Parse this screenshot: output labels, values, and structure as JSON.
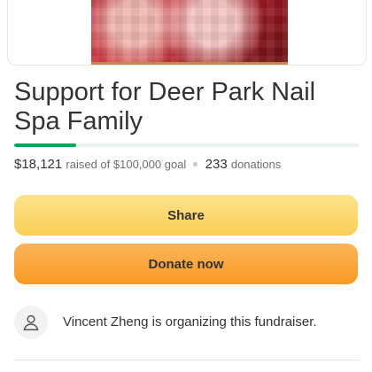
{
  "campaign": {
    "title": "Support for Deer Park Nail Spa Family",
    "progress_fraction": 0.181
  },
  "stats": {
    "raised": "$18,121",
    "raised_suffix": "raised of $100,000 goal",
    "donations_count": "233",
    "donations_label": "donations"
  },
  "actions": {
    "share_label": "Share",
    "donate_label": "Donate now"
  },
  "organizer": {
    "text": "Vincent Zheng is organizing this fundraiser.",
    "icon": "user-icon"
  },
  "colors": {
    "progress": "#02a95c",
    "share_button": "#f9cf55",
    "donate_button": "#f89a22"
  }
}
